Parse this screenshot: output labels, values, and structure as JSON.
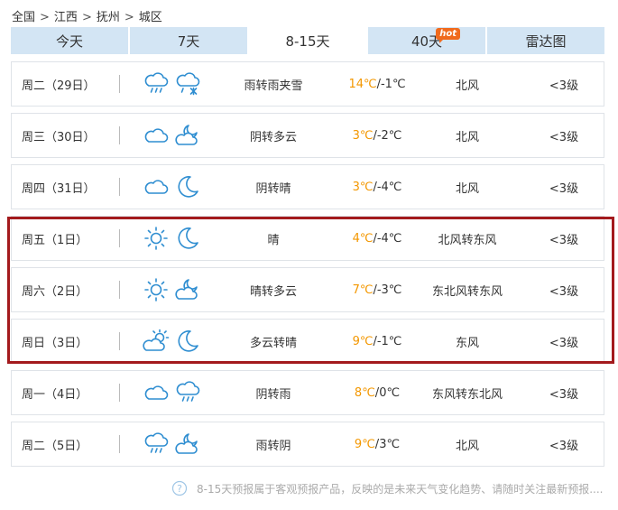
{
  "breadcrumb": {
    "items": [
      "全国",
      "江西",
      "抚州",
      "城区"
    ],
    "separator": ">"
  },
  "tabs": [
    {
      "label": "今天",
      "active": false
    },
    {
      "label": "7天",
      "active": false
    },
    {
      "label": "8-15天",
      "active": true
    },
    {
      "label": "40天",
      "active": false,
      "badge": "hot"
    },
    {
      "label": "雷达图",
      "active": false
    }
  ],
  "forecast": [
    {
      "day": "周二（29日）",
      "day_icon": "rain-cloud-icon",
      "night_icon": "rain-snow-icon",
      "desc": "雨转雨夹雪",
      "high": "14℃",
      "low": "-1℃",
      "wind": "北风",
      "level": "<3级"
    },
    {
      "day": "周三（30日）",
      "day_icon": "cloudy-icon",
      "night_icon": "partly-cloudy-night-icon",
      "desc": "阴转多云",
      "high": "3℃",
      "low": "-2℃",
      "wind": "北风",
      "level": "<3级"
    },
    {
      "day": "周四（31日）",
      "day_icon": "cloudy-icon",
      "night_icon": "moon-icon",
      "desc": "阴转晴",
      "high": "3℃",
      "low": "-4℃",
      "wind": "北风",
      "level": "<3级"
    },
    {
      "day": "周五（1日）",
      "day_icon": "sun-icon",
      "night_icon": "moon-icon",
      "desc": "晴",
      "high": "4℃",
      "low": "-4℃",
      "wind": "北风转东风",
      "level": "<3级"
    },
    {
      "day": "周六（2日）",
      "day_icon": "sun-icon",
      "night_icon": "partly-cloudy-night-icon",
      "desc": "晴转多云",
      "high": "7℃",
      "low": "-3℃",
      "wind": "东北风转东风",
      "level": "<3级"
    },
    {
      "day": "周日（3日）",
      "day_icon": "partly-cloudy-day-icon",
      "night_icon": "moon-icon",
      "desc": "多云转晴",
      "high": "9℃",
      "low": "-1℃",
      "wind": "东风",
      "level": "<3级"
    },
    {
      "day": "周一（4日）",
      "day_icon": "cloudy-icon",
      "night_icon": "rain-cloud-icon",
      "desc": "阴转雨",
      "high": "8℃",
      "low": "0℃",
      "wind": "东风转东北风",
      "level": "<3级"
    },
    {
      "day": "周二（5日）",
      "day_icon": "rain-cloud-icon",
      "night_icon": "partly-cloudy-night-icon",
      "desc": "雨转阴",
      "high": "9℃",
      "low": "3℃",
      "wind": "北风",
      "level": "<3级"
    }
  ],
  "temp_separator": "/",
  "footer": {
    "note": "8-15天预报属于客观预报产品，反映的是未来天气变化趋势、请随时关注最新预报....",
    "icon": "help-icon"
  },
  "colors": {
    "tab_bg": "#d3e5f4",
    "tab_active_bg": "#ffffff",
    "high_temp": "#f39700",
    "icon_blue": "#2f8ed1",
    "highlight_border": "#a31a1d",
    "hot_badge": "#f06a1d"
  }
}
